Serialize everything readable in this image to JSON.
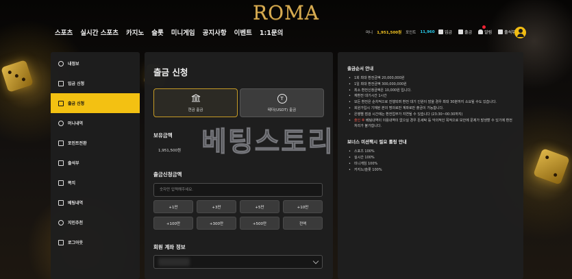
{
  "logo": "ROMA",
  "nav": [
    "스포츠",
    "실시간 스포츠",
    "카지노",
    "슬롯",
    "미니게임",
    "공지사항",
    "이벤트",
    "1:1문의"
  ],
  "wallet": {
    "cash_label": "머니",
    "cash_value": "1,951,500원",
    "point_label": "포인트",
    "point_value": "11,960"
  },
  "header_buttons": {
    "deposit": "입금",
    "withdraw": "출금",
    "alarm": "알림",
    "attendance": "출석부"
  },
  "sidebar": {
    "items": [
      {
        "label": "내정보",
        "icon": "user-icon"
      },
      {
        "label": "입금 신청",
        "icon": "deposit-icon"
      },
      {
        "label": "출금 신청",
        "icon": "withdraw-icon"
      },
      {
        "label": "머니내역",
        "icon": "clock-icon"
      },
      {
        "label": "포인트전환",
        "icon": "exchange-icon"
      },
      {
        "label": "출석부",
        "icon": "calendar-icon"
      },
      {
        "label": "쪽지",
        "icon": "mail-icon"
      },
      {
        "label": "베팅내역",
        "icon": "list-icon"
      },
      {
        "label": "지인추천",
        "icon": "users-icon"
      },
      {
        "label": "로그아웃",
        "icon": "logout-icon"
      }
    ],
    "active_index": 2
  },
  "main": {
    "title": "출금 신청",
    "method_krw": "현금 출금",
    "method_usdt": "테더(USDT) 출금",
    "balance_label": "보유금액",
    "balance_value": "1,951,500원",
    "amount_label": "출금신청금액",
    "amount_placeholder": "숫자만 입력해주세요.",
    "quick_buttons": [
      "+1만",
      "+3만",
      "+5만",
      "+10만",
      "+100만",
      "+300만",
      "+500만",
      "전액"
    ],
    "account_label": "회원 계좌 정보"
  },
  "info": {
    "title1": "출금순서 안내",
    "lines": [
      "1회 최대 환전금액 20,000,000원",
      "1일 최대 환전금액 300,000,000원",
      "최소 환전신청금액은 10,000원 입니다.",
      "재환전 대기시간 1시간",
      "모든 환전은 순차적으로 진행되며 환전 대기 인원이 많을 경우 최대 30분까지 소요될 수도 있습니다.",
      "회원가입시 기재된 본의 명의로만 계좌로만 출금이 가능합니다.",
      "은행별 점검 시간에는 환전업무가 지연될 수 있습니다 (23:30~00:30까지)"
    ],
    "red_prefix": "출인 후",
    "red_rest": " 베팅내역이 이용내역이 없으실 경우 돈세탁 등 악의적인 목적으로 보안에 문제가 발생할 수 있기에 환전처리가 불가합니다.",
    "title2": "보너스 미션팩시 필요 롤링 안내",
    "rolling": [
      "스포츠 100%",
      "실시간 100%",
      "미니게임 100%",
      "카지노/슬롯 100%"
    ]
  },
  "watermark": "베팅스토리"
}
